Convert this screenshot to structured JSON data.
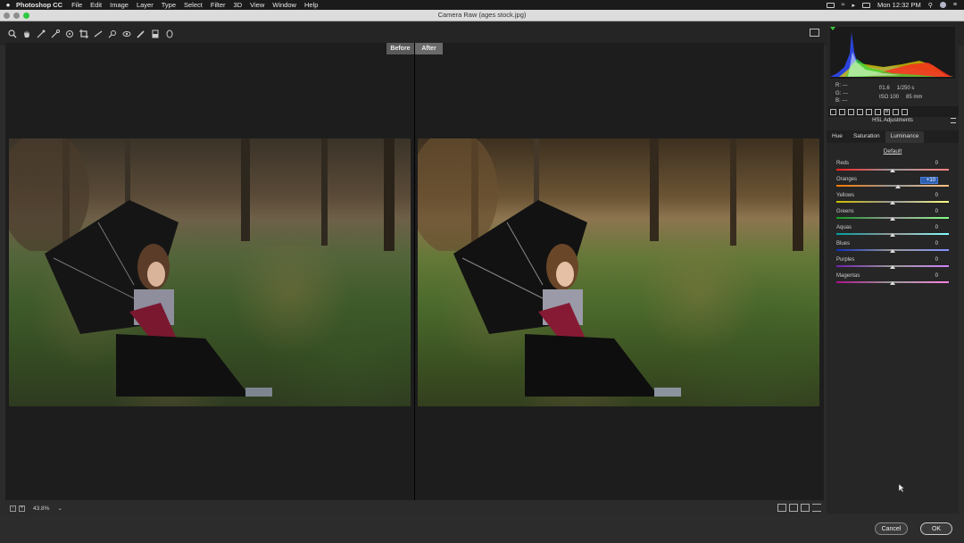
{
  "menubar": {
    "app": "Photoshop CC",
    "items": [
      "File",
      "Edit",
      "Image",
      "Layer",
      "Type",
      "Select",
      "Filter",
      "3D",
      "View",
      "Window",
      "Help"
    ],
    "clock": "Mon 12:32 PM"
  },
  "window": {
    "title": "Camera Raw (ages stock.jpg)"
  },
  "toolbar": {
    "tools": [
      "zoom-tool-icon",
      "hand-tool-icon",
      "white-balance-icon",
      "color-sampler-icon",
      "target-adjust-icon",
      "crop-icon",
      "straighten-icon",
      "spot-removal-icon",
      "red-eye-icon",
      "adjustment-brush-icon",
      "graduated-filter-icon",
      "radial-filter-icon"
    ]
  },
  "view": {
    "before_label": "Before",
    "after_label": "After",
    "zoom": "43.8%"
  },
  "info": {
    "r_label": "R:",
    "g_label": "G:",
    "b_label": "B:",
    "r": "---",
    "g": "---",
    "b": "---",
    "aperture": "f/1.6",
    "shutter": "1/250 s",
    "iso": "ISO 100",
    "focal": "85 mm"
  },
  "panel": {
    "title": "HSL Adjustments",
    "tabs": [
      "Hue",
      "Saturation",
      "Luminance"
    ],
    "active_tab": "Luminance",
    "default_label": "Default",
    "sliders": [
      {
        "label": "Reds",
        "value": "0",
        "pos": 0.5,
        "colors": [
          "#ff2020",
          "#ff8080"
        ]
      },
      {
        "label": "Oranges",
        "value": "+10",
        "pos": 0.55,
        "colors": [
          "#ff7a00",
          "#ffc080"
        ]
      },
      {
        "label": "Yellows",
        "value": "0",
        "pos": 0.5,
        "colors": [
          "#d0c000",
          "#ffff80"
        ]
      },
      {
        "label": "Greens",
        "value": "0",
        "pos": 0.5,
        "colors": [
          "#10a020",
          "#80ff80"
        ]
      },
      {
        "label": "Aquas",
        "value": "0",
        "pos": 0.5,
        "colors": [
          "#00a0a0",
          "#80ffff"
        ]
      },
      {
        "label": "Blues",
        "value": "0",
        "pos": 0.5,
        "colors": [
          "#1030c0",
          "#8090ff"
        ]
      },
      {
        "label": "Purples",
        "value": "0",
        "pos": 0.5,
        "colors": [
          "#7020b0",
          "#d080ff"
        ]
      },
      {
        "label": "Magentas",
        "value": "0",
        "pos": 0.5,
        "colors": [
          "#b01090",
          "#ff80e0"
        ]
      }
    ]
  },
  "buttons": {
    "cancel": "Cancel",
    "ok": "OK"
  }
}
